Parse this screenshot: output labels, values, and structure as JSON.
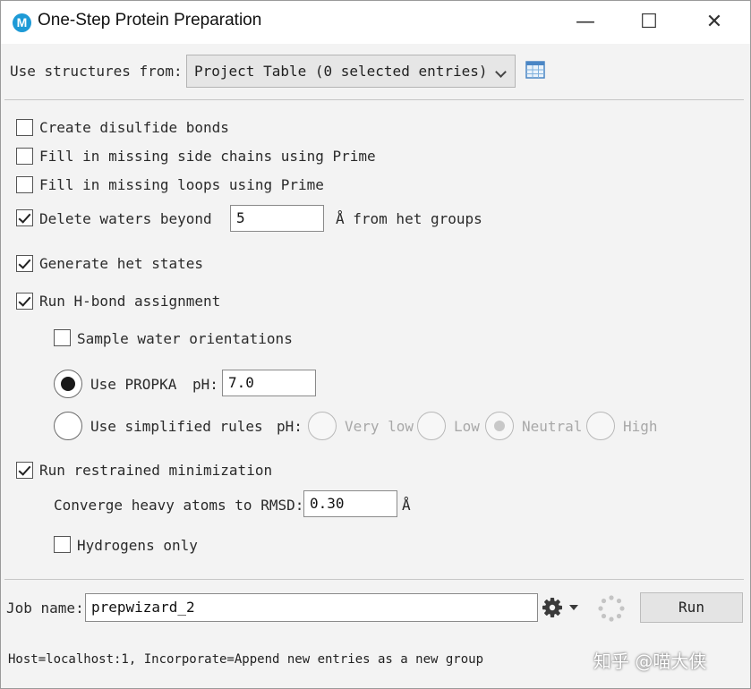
{
  "window": {
    "app_icon": "M",
    "title": "One-Step Protein Preparation",
    "controls": {
      "minimize": "—",
      "maximize": "☐",
      "close": "✕"
    }
  },
  "source": {
    "label": "Use structures from:",
    "selected": "Project Table (0 selected entries)",
    "table_icon": "table-icon"
  },
  "options": {
    "disulfide": {
      "label": "Create disulfide bonds",
      "checked": false
    },
    "side_chains": {
      "label": "Fill in missing side chains using Prime",
      "checked": false
    },
    "loops": {
      "label": "Fill in missing loops using Prime",
      "checked": false
    },
    "waters": {
      "label": "Delete waters beyond",
      "value": "5",
      "suffix": "Å from het groups",
      "checked": true
    },
    "het_states": {
      "label": "Generate het states",
      "checked": true
    },
    "hbond": {
      "label": "Run H-bond assignment",
      "checked": true
    },
    "sample_water": {
      "label": "Sample water orientations",
      "checked": false
    },
    "propka": {
      "label": "Use PROPKA",
      "ph_label": "pH:",
      "ph_value": "7.0",
      "selected": true
    },
    "simplified": {
      "label": "Use simplified rules",
      "ph_label": "pH:",
      "choices": [
        "Very low",
        "Low",
        "Neutral",
        "High"
      ],
      "selected_choice": "Neutral",
      "selected": false
    },
    "minimization": {
      "label": "Run restrained minimization",
      "checked": true
    },
    "rmsd": {
      "label": "Converge heavy atoms to RMSD:",
      "value": "0.30",
      "unit": "Å"
    },
    "hydrogens": {
      "label": "Hydrogens only",
      "checked": false
    }
  },
  "job": {
    "label": "Job name:",
    "value": "prepwizard_2",
    "settings_icon": "gear-icon",
    "run_label": "Run"
  },
  "status": "Host=localhost:1, Incorporate=Append new entries as a new group",
  "watermark": "知乎 @喵大侠"
}
